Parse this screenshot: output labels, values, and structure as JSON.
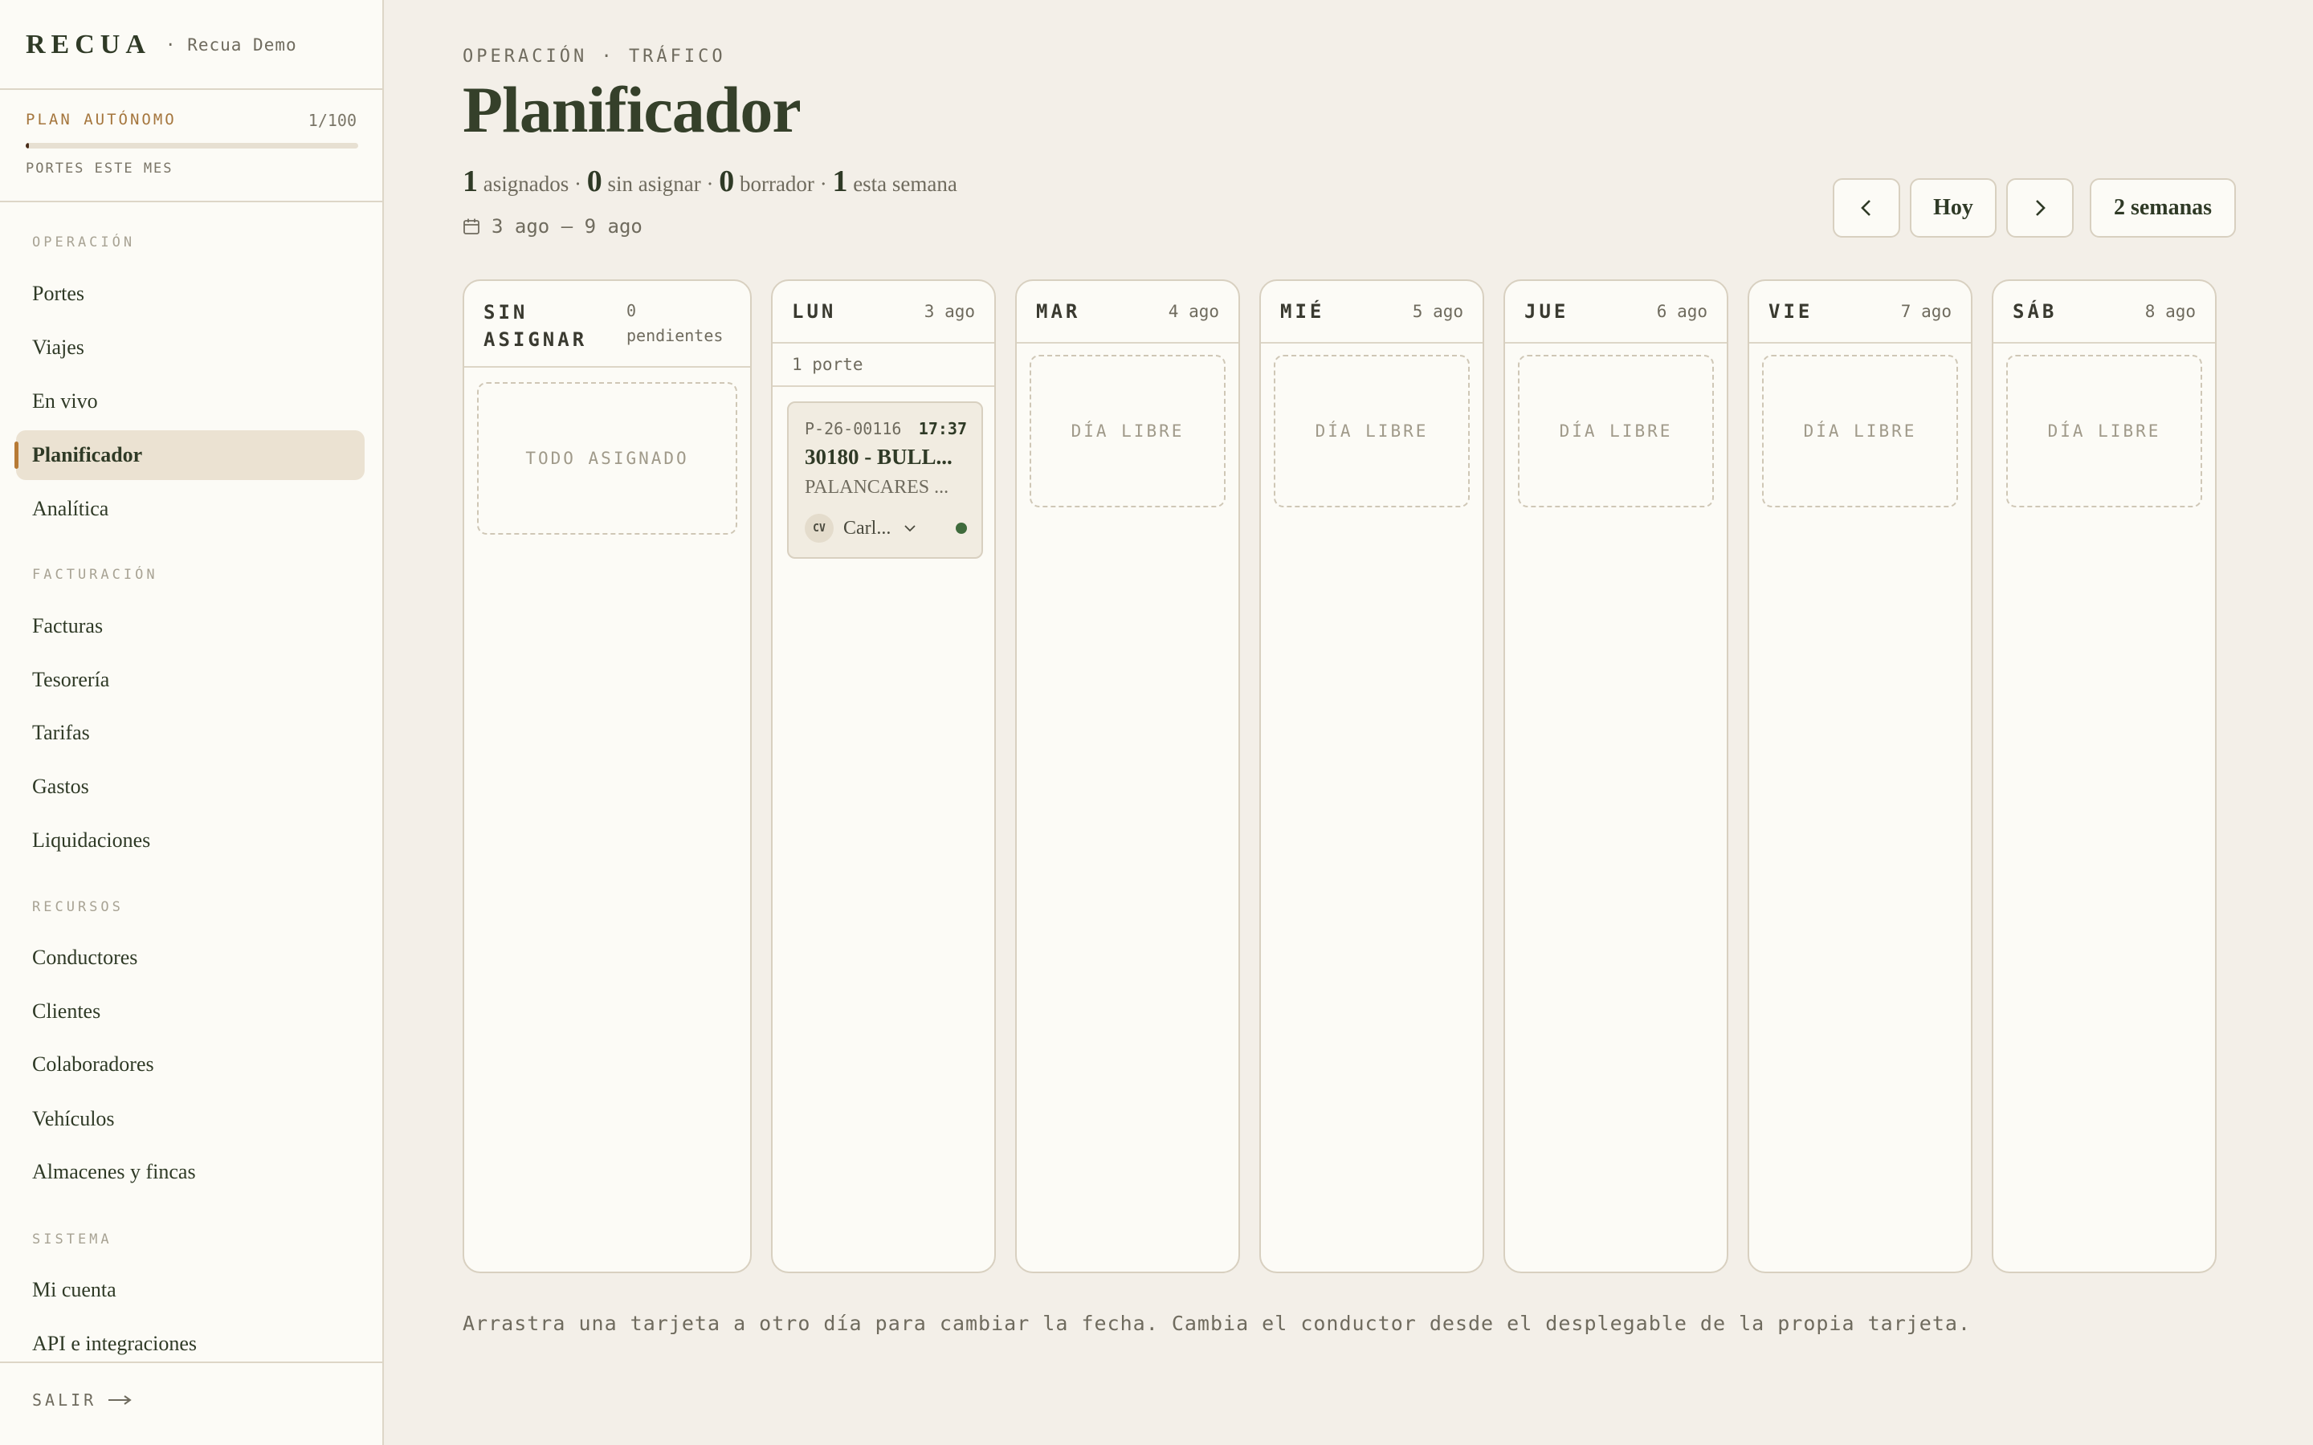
{
  "sidebar": {
    "brand": "RECUA",
    "org": "· Recua Demo",
    "plan": {
      "label": "PLAN AUTÓNOMO",
      "count": "1/100",
      "progress": 0.01,
      "sub": "PORTES ESTE MES"
    },
    "sections": [
      {
        "title": "OPERACIÓN",
        "items": [
          "Portes",
          "Viajes",
          "En vivo",
          "Planificador",
          "Analítica"
        ]
      },
      {
        "title": "FACTURACIÓN",
        "items": [
          "Facturas",
          "Tesorería",
          "Tarifas",
          "Gastos",
          "Liquidaciones"
        ]
      },
      {
        "title": "RECURSOS",
        "items": [
          "Conductores",
          "Clientes",
          "Colaboradores",
          "Vehículos",
          "Almacenes y fincas"
        ]
      },
      {
        "title": "SISTEMA",
        "items": [
          "Mi cuenta",
          "API e integraciones"
        ]
      }
    ],
    "active_item": "Planificador",
    "logout": "SALIR",
    "logout_icon": "arrow-right-icon"
  },
  "header": {
    "eyebrow": "OPERACIÓN · TRÁFICO",
    "title": "Planificador",
    "stats": [
      {
        "value": "1",
        "label": "asignados"
      },
      {
        "value": "0",
        "label": "sin asignar"
      },
      {
        "value": "0",
        "label": "borrador"
      },
      {
        "value": "1",
        "label": "esta semana"
      }
    ],
    "range": "3 ago — 9 ago",
    "range_icon": "calendar-icon"
  },
  "controls": {
    "prev_icon": "chevron-left-icon",
    "today": "Hoy",
    "next_icon": "chevron-right-icon",
    "view": "2 semanas"
  },
  "unassigned": {
    "name_line1": "SIN",
    "name_line2": "ASIGNAR",
    "count_line1": "0",
    "count_line2": "pendientes",
    "empty": "TODO ASIGNADO"
  },
  "days": [
    {
      "name": "LUN",
      "date": "3 ago",
      "summary": "1 porte",
      "cards": [
        {
          "ref": "P-26-00116",
          "time": "17:37",
          "title": "30180 - BULL...",
          "subtitle": "PALANCARES ...",
          "driver_initials": "CV",
          "driver": "Carl...",
          "status_color": "#3f6b3c"
        }
      ]
    },
    {
      "name": "MAR",
      "date": "4 ago",
      "empty": "DÍA LIBRE"
    },
    {
      "name": "MIÉ",
      "date": "5 ago",
      "empty": "DÍA LIBRE"
    },
    {
      "name": "JUE",
      "date": "6 ago",
      "empty": "DÍA LIBRE"
    },
    {
      "name": "VIE",
      "date": "7 ago",
      "empty": "DÍA LIBRE"
    },
    {
      "name": "SÁB",
      "date": "8 ago",
      "empty": "DÍA LIBRE"
    }
  ],
  "hint": "Arrastra una tarjeta a otro día para cambiar la fecha. Cambia el conductor desde el desplegable de la propia tarjeta.",
  "colors": {
    "accent": "#b77a35",
    "text": "#2f3a26",
    "background": "#f3efe8",
    "panel": "#fcfbf6"
  }
}
